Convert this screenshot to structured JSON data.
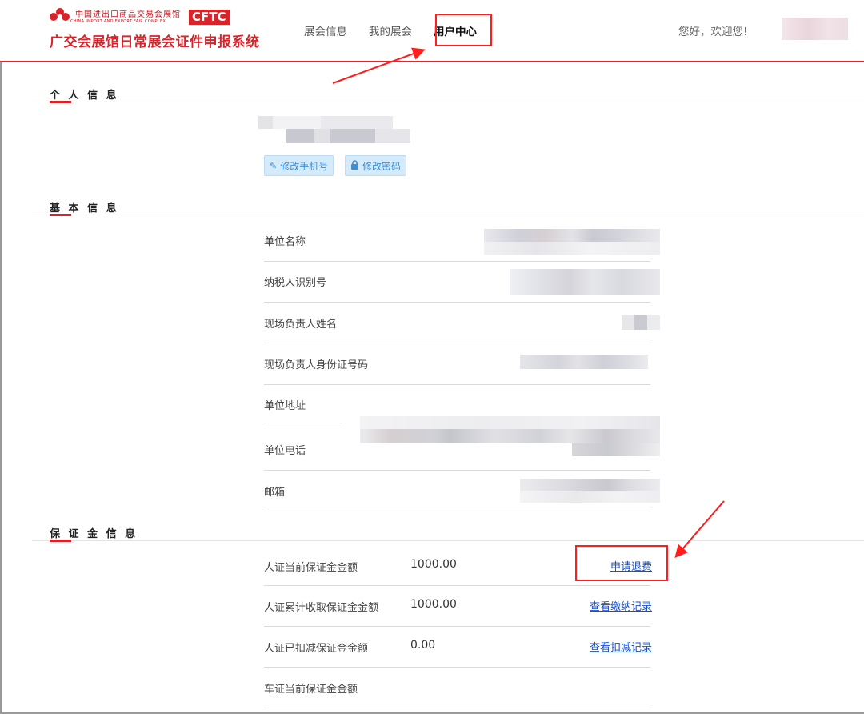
{
  "header": {
    "logo_cn": "中国进出口商品交易会展馆",
    "logo_en": "CHINA IMPORT AND EXPORT FAIR COMPLEX",
    "logo_badge": "CFTC",
    "system_title": "广交会展馆日常展会证件申报系统",
    "nav": [
      {
        "label": "展会信息"
      },
      {
        "label": "我的展会"
      },
      {
        "label": "用户中心",
        "active": true
      }
    ],
    "greeting": "您好，欢迎您!"
  },
  "personal": {
    "title": "个 人 信 息",
    "btn_phone": "修改手机号",
    "btn_password": "修改密码",
    "icon_phone": "pencil-icon",
    "icon_password": "lock-icon"
  },
  "basic": {
    "title": "基 本 信 息",
    "rows": [
      {
        "label": "单位名称"
      },
      {
        "label": "纳税人识别号"
      },
      {
        "label": "现场负责人姓名"
      },
      {
        "label": "现场负责人身份证号码"
      },
      {
        "label": "单位地址"
      },
      {
        "label": "单位电话"
      },
      {
        "label": "邮箱"
      }
    ]
  },
  "deposit": {
    "title": "保 证 金 信 息",
    "rows": [
      {
        "label": "人证当前保证金金额",
        "value": "1000.00",
        "link": "申请退费"
      },
      {
        "label": "人证累计收取保证金金额",
        "value": "1000.00",
        "link": "查看缴纳记录"
      },
      {
        "label": "人证已扣减保证金金额",
        "value": "0.00",
        "link": "查看扣减记录"
      },
      {
        "label": "车证当前保证金金额",
        "value": "",
        "link": ""
      }
    ]
  },
  "colors": {
    "brand_red": "#d7232a",
    "annotation_red": "#ff1d1d",
    "link_blue": "#1a4fc9",
    "button_bg": "#d6ebfa"
  }
}
